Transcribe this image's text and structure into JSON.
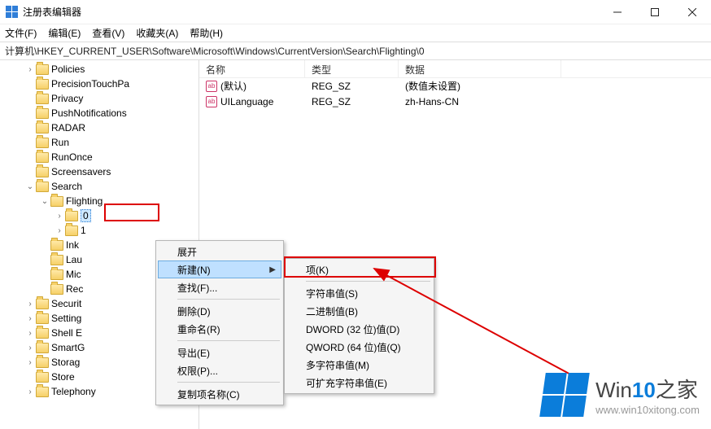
{
  "window": {
    "title": "注册表编辑器"
  },
  "menu": {
    "file": "文件(F)",
    "edit": "编辑(E)",
    "view": "查看(V)",
    "favorites": "收藏夹(A)",
    "help": "帮助(H)"
  },
  "addressbar": {
    "path": "计算机\\HKEY_CURRENT_USER\\Software\\Microsoft\\Windows\\CurrentVersion\\Search\\Flighting\\0"
  },
  "tree": {
    "items": [
      {
        "indent": 5,
        "exp": ">",
        "label": "Policies"
      },
      {
        "indent": 5,
        "exp": "",
        "label": "PrecisionTouchPa"
      },
      {
        "indent": 5,
        "exp": "",
        "label": "Privacy"
      },
      {
        "indent": 5,
        "exp": "",
        "label": "PushNotifications"
      },
      {
        "indent": 5,
        "exp": "",
        "label": "RADAR"
      },
      {
        "indent": 5,
        "exp": "",
        "label": "Run"
      },
      {
        "indent": 5,
        "exp": "",
        "label": "RunOnce"
      },
      {
        "indent": 5,
        "exp": "",
        "label": "Screensavers"
      },
      {
        "indent": 5,
        "exp": "v",
        "label": "Search"
      },
      {
        "indent": 6,
        "exp": "v",
        "label": "Flighting"
      },
      {
        "indent": 7,
        "exp": ">",
        "label": "0",
        "selected": true
      },
      {
        "indent": 7,
        "exp": ">",
        "label": "1"
      },
      {
        "indent": 6,
        "exp": "",
        "label": "Ink"
      },
      {
        "indent": 6,
        "exp": "",
        "label": "Lau"
      },
      {
        "indent": 6,
        "exp": "",
        "label": "Mic"
      },
      {
        "indent": 6,
        "exp": "",
        "label": "Rec"
      },
      {
        "indent": 5,
        "exp": ">",
        "label": "Securit"
      },
      {
        "indent": 5,
        "exp": ">",
        "label": "Setting"
      },
      {
        "indent": 5,
        "exp": ">",
        "label": "Shell E"
      },
      {
        "indent": 5,
        "exp": ">",
        "label": "SmartG"
      },
      {
        "indent": 5,
        "exp": ">",
        "label": "Storag"
      },
      {
        "indent": 5,
        "exp": "",
        "label": "Store"
      },
      {
        "indent": 5,
        "exp": ">",
        "label": "Telephony"
      }
    ]
  },
  "list": {
    "headers": {
      "name": "名称",
      "type": "类型",
      "data": "数据"
    },
    "rows": [
      {
        "name": "(默认)",
        "type": "REG_SZ",
        "data": "(数值未设置)"
      },
      {
        "name": "UILanguage",
        "type": "REG_SZ",
        "data": "zh-Hans-CN"
      }
    ]
  },
  "ctx1": {
    "expand": "展开",
    "new": "新建(N)",
    "find": "查找(F)...",
    "delete": "删除(D)",
    "rename": "重命名(R)",
    "export": "导出(E)",
    "perm": "权限(P)...",
    "copykey": "复制项名称(C)"
  },
  "ctx2": {
    "key": "项(K)",
    "string": "字符串值(S)",
    "binary": "二进制值(B)",
    "dword": "DWORD (32 位)值(D)",
    "qword": "QWORD (64 位)值(Q)",
    "multi": "多字符串值(M)",
    "expand": "可扩充字符串值(E)"
  },
  "watermark": {
    "brand_a": "Win",
    "brand_b": "10",
    "brand_c": "之家",
    "url": "www.win10xitong.com"
  }
}
